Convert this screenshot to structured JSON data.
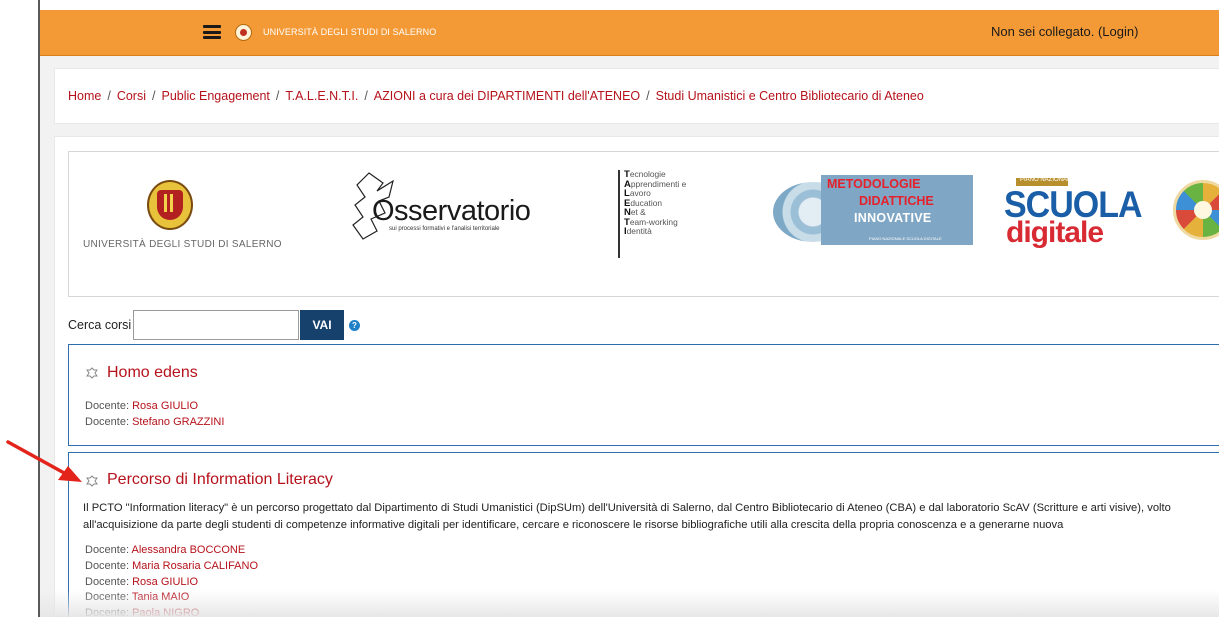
{
  "header": {
    "site_name": "UNIVERSITÀ DEGLI STUDI DI SALERNO",
    "login_status": "Non sei collegato. (Login)",
    "icons": [
      "hamburger-menu-icon",
      "university-logo-icon"
    ],
    "color": "#f39a36"
  },
  "breadcrumb": [
    "Home",
    "Corsi",
    "Public Engagement",
    "T.A.L.E.N.T.I.",
    "AZIONI a cura dei DIPARTIMENTI dell'ATENEO",
    "Studi Umanistici e Centro Bibliotecario di Ateneo"
  ],
  "banner": {
    "unisa_caption": "UNIVERSITÀ DEGLI STUDI DI SALERNO",
    "osservatorio": {
      "title": "Osservatorio",
      "subtitle": "sui processi formativi e l'analisi territoriale"
    },
    "talenti_lines": [
      {
        "initial": "T",
        "rest": "ecnologie"
      },
      {
        "initial": "A",
        "rest": "pprendimenti e"
      },
      {
        "initial": "L",
        "rest": "avoro"
      },
      {
        "initial": "E",
        "rest": "ducation"
      },
      {
        "initial": "N",
        "rest": "et &"
      },
      {
        "initial": "T",
        "rest": "eam-working"
      },
      {
        "initial": "I",
        "rest": "dentità"
      }
    ],
    "metodologie": {
      "line1": "METODOLOGIE",
      "line2": "DIDATTICHE",
      "line3": "INNOVATIVE",
      "sub": "PIANO NAZIONALE SCUOLA DIGITALE"
    },
    "scuola_digitale": {
      "tag": "PIANO NAZIONALE",
      "word1": "SCUOLA",
      "word2": "digitale"
    }
  },
  "search": {
    "label": "Cerca corsi",
    "value": "",
    "button_label": "VAI",
    "help_icon": "?"
  },
  "courses": [
    {
      "title": "Homo edens",
      "summary": "",
      "teachers": [
        {
          "role": "Docente: ",
          "name": "Rosa GIULIO"
        },
        {
          "role": "Docente: ",
          "name": "Stefano GRAZZINI"
        }
      ]
    },
    {
      "title": "Percorso di Information Literacy",
      "summary": "Il PCTO  \"Information literacy\" è un percorso progettato dal Dipartimento di Studi Umanistici (DipSUm) dell'Università di Salerno, dal Centro Bibliotecario di Ateneo (CBA) e dal laboratorio ScAV  (Scritture e arti visive), volto all'acquisizione da parte  degli studenti di competenze informative digitali per identificare, cercare e riconoscere le risorse bibliografiche utili alla crescita della propria conoscenza e a generarne nuova",
      "teachers": [
        {
          "role": "Docente: ",
          "name": "Alessandra BOCCONE"
        },
        {
          "role": "Docente: ",
          "name": "Maria Rosaria CALIFANO"
        },
        {
          "role": "Docente: ",
          "name": "Rosa GIULIO"
        },
        {
          "role": "Docente: ",
          "name": "Tania MAIO"
        },
        {
          "role": "Docente: ",
          "name": "Paola NIGRO"
        }
      ]
    }
  ],
  "colors": {
    "accent_orange": "#f39a36",
    "link_red": "#b5121b",
    "button_blue": "#17416d",
    "box_border_blue": "#2f6fae",
    "annotation_arrow": "#e3241b"
  }
}
